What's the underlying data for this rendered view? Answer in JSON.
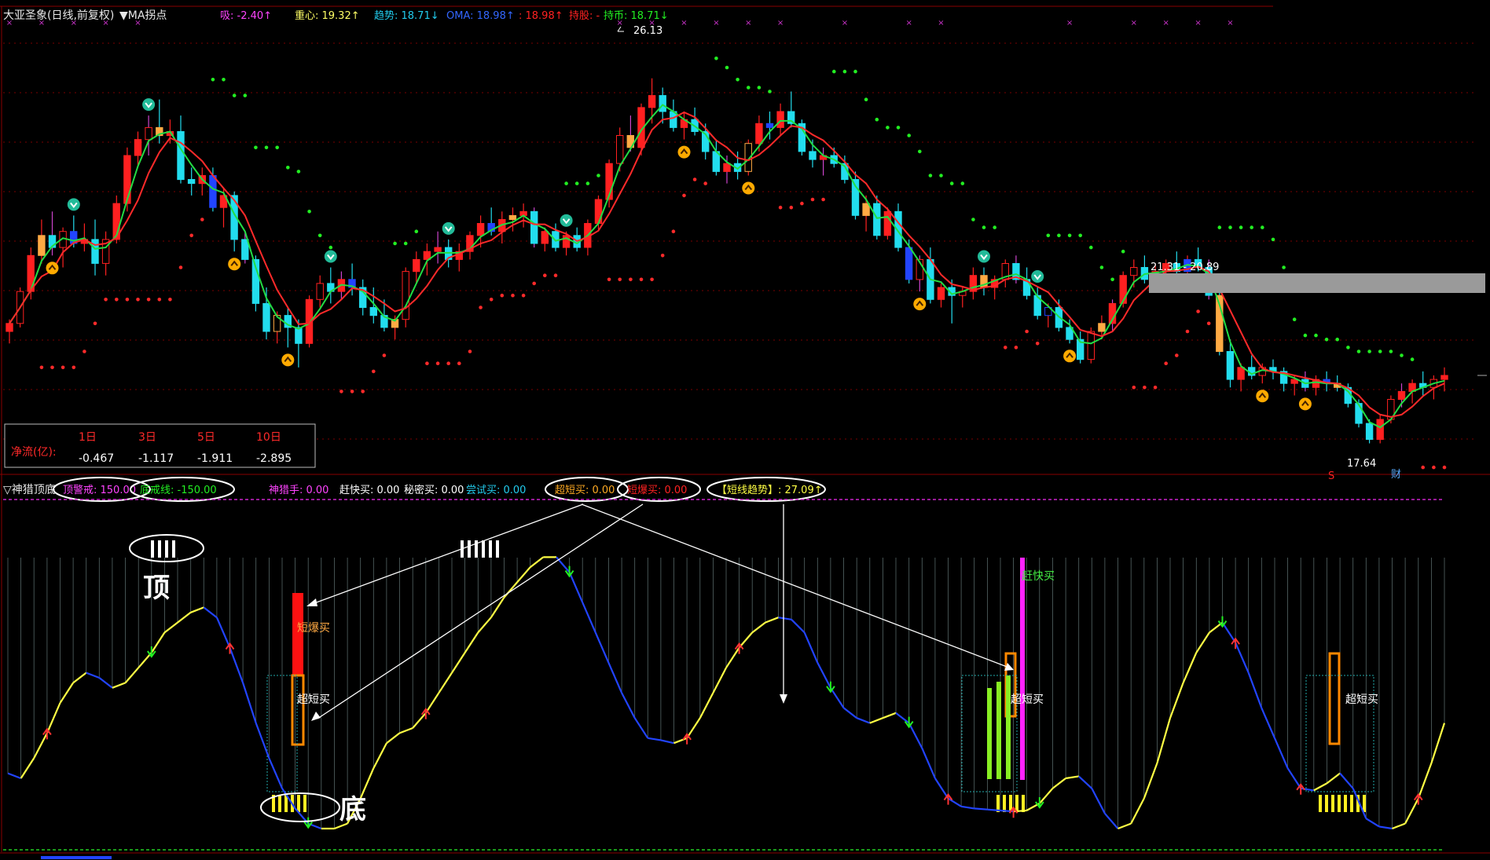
{
  "colors": {
    "bg": "#000000",
    "up": "#ff2020",
    "down": "#22ddee",
    "grid": "#7a0000",
    "ma_fast": "#ff2a2a",
    "ma_mid": "#22dd44",
    "dots_green": "#22ee22",
    "dots_red": "#ff2a2a",
    "osc_yellow": "#ffff44",
    "osc_blue": "#2244ff",
    "magenta": "#ff22ff",
    "white": "#ffffff"
  },
  "header": {
    "title": "大亚圣象(日线,前复权)",
    "ma_label": "▼MA拐点",
    "items": [
      {
        "label": "吸: -2.40",
        "color": "#ff44ff",
        "arrow": "up"
      },
      {
        "label": "重心: 19.32",
        "color": "#ffff66",
        "arrow": "up"
      },
      {
        "label": "趋势: 18.71",
        "color": "#22ccee",
        "arrow": "down"
      },
      {
        "label": "OMA: 18.98",
        "color": "#3366ff",
        "arrow": "up"
      },
      {
        "label": ": 18.98",
        "color": "#ff2222",
        "arrow": "up"
      },
      {
        "label": "持股: -",
        "color": "#ff2222",
        "arrow": "none"
      },
      {
        "label": "持币: 18.71",
        "color": "#22ee22",
        "arrow": "down"
      }
    ]
  },
  "price_annotations": {
    "high_label": "26.13",
    "low_label": "17.64",
    "range_label": "21.31 - 20.89",
    "marker_s": "S",
    "marker_cai": "财"
  },
  "netflow": {
    "row_label": "净流(亿):",
    "headers": [
      "1日",
      "3日",
      "5日",
      "10日"
    ],
    "values": [
      "-0.467",
      "-1.117",
      "-1.911",
      "-2.895"
    ]
  },
  "indicator": {
    "name": "▽神猎顶底",
    "items": [
      {
        "label": "顶警戒: 150.00",
        "color": "#ff44ff",
        "circled": true
      },
      {
        "label": "底戒线: -150.00",
        "color": "#22ee22",
        "circled": true
      },
      {
        "label": "神猎手: 0.00",
        "color": "#ff44ff",
        "circled": false
      },
      {
        "label": "赶快买: 0.00",
        "color": "#ffffff",
        "circled": false
      },
      {
        "label": "秘密买: 0.00",
        "color": "#ffffff",
        "circled": false
      },
      {
        "label": "尝试买: 0.00",
        "color": "#22ccee",
        "circled": false
      },
      {
        "label": "超短买: 0.00",
        "color": "#ffaa22",
        "circled": true
      },
      {
        "label": "短爆买: 0.00",
        "color": "#ff2222",
        "circled": true
      },
      {
        "label": "【短线趋势】: 27.09↑",
        "color": "#ffff44",
        "circled": true
      }
    ],
    "top_label": "顶",
    "bottom_label": "底",
    "bar_labels": {
      "duanbao": "短爆买",
      "chaoduan": "超短买",
      "gankuai": "赶快买"
    }
  },
  "chart_data": {
    "type": "candlestick",
    "title": "大亚圣象(日线,前复权)",
    "ylim": [
      16.5,
      27.5
    ],
    "annotated_high": 26.13,
    "annotated_low": 17.64,
    "candles": [
      [
        19.8,
        20.1,
        19.5,
        20.0
      ],
      [
        20.0,
        20.9,
        19.9,
        20.8
      ],
      [
        20.8,
        21.9,
        20.6,
        21.7
      ],
      [
        21.7,
        22.6,
        21.5,
        22.2
      ],
      [
        22.2,
        22.8,
        21.7,
        21.9
      ],
      [
        21.9,
        22.4,
        21.4,
        22.3
      ],
      [
        22.3,
        22.7,
        21.9,
        22.0
      ],
      [
        22.0,
        22.5,
        21.8,
        22.1
      ],
      [
        22.1,
        22.6,
        21.2,
        21.5
      ],
      [
        21.5,
        22.3,
        21.2,
        22.1
      ],
      [
        22.1,
        23.2,
        22.0,
        23.0
      ],
      [
        23.0,
        24.4,
        22.8,
        24.2
      ],
      [
        24.2,
        24.8,
        23.9,
        24.6
      ],
      [
        24.6,
        25.2,
        24.2,
        24.9
      ],
      [
        24.9,
        25.6,
        24.5,
        24.7
      ],
      [
        24.7,
        25.1,
        24.5,
        24.8
      ],
      [
        24.8,
        25.2,
        23.5,
        23.6
      ],
      [
        23.6,
        23.9,
        23.2,
        23.5
      ],
      [
        23.5,
        23.9,
        23.2,
        23.7
      ],
      [
        23.7,
        23.9,
        22.8,
        22.9
      ],
      [
        22.9,
        23.4,
        22.4,
        23.2
      ],
      [
        23.2,
        23.3,
        21.8,
        22.1
      ],
      [
        22.1,
        22.3,
        21.5,
        21.6
      ],
      [
        21.6,
        21.7,
        20.3,
        20.5
      ],
      [
        20.5,
        20.9,
        19.6,
        19.8
      ],
      [
        19.8,
        20.3,
        19.5,
        20.2
      ],
      [
        20.2,
        20.4,
        19.4,
        19.9
      ],
      [
        19.9,
        20.1,
        18.9,
        19.5
      ],
      [
        19.5,
        20.7,
        19.4,
        20.6
      ],
      [
        20.6,
        21.2,
        20.4,
        21.0
      ],
      [
        21.0,
        21.4,
        20.5,
        20.8
      ],
      [
        20.8,
        21.3,
        20.6,
        21.1
      ],
      [
        21.1,
        21.5,
        20.7,
        20.9
      ],
      [
        20.9,
        21.1,
        20.2,
        20.4
      ],
      [
        20.4,
        20.9,
        20.0,
        20.2
      ],
      [
        20.2,
        20.6,
        19.8,
        19.9
      ],
      [
        19.9,
        20.2,
        19.6,
        20.1
      ],
      [
        20.1,
        21.4,
        19.9,
        21.3
      ],
      [
        21.3,
        21.8,
        21.0,
        21.6
      ],
      [
        21.6,
        22.0,
        21.2,
        21.8
      ],
      [
        21.8,
        22.3,
        21.5,
        21.9
      ],
      [
        21.9,
        22.1,
        21.4,
        21.6
      ],
      [
        21.6,
        22.0,
        21.3,
        21.8
      ],
      [
        21.8,
        22.3,
        21.6,
        22.2
      ],
      [
        22.2,
        22.7,
        21.9,
        22.5
      ],
      [
        22.5,
        22.9,
        22.2,
        22.3
      ],
      [
        22.3,
        22.8,
        22.0,
        22.6
      ],
      [
        22.6,
        22.9,
        22.3,
        22.7
      ],
      [
        22.7,
        23.0,
        22.4,
        22.8
      ],
      [
        22.8,
        22.9,
        21.9,
        22.0
      ],
      [
        22.0,
        22.4,
        21.8,
        22.3
      ],
      [
        22.3,
        22.5,
        21.8,
        21.9
      ],
      [
        21.9,
        22.3,
        21.7,
        22.2
      ],
      [
        22.2,
        22.4,
        21.8,
        21.9
      ],
      [
        21.9,
        22.6,
        21.7,
        22.5
      ],
      [
        22.5,
        23.2,
        22.3,
        23.1
      ],
      [
        23.1,
        24.1,
        22.9,
        24.0
      ],
      [
        24.0,
        24.9,
        23.8,
        24.7
      ],
      [
        24.7,
        25.2,
        24.3,
        24.4
      ],
      [
        24.4,
        25.5,
        24.2,
        25.4
      ],
      [
        25.4,
        26.13,
        25.0,
        25.7
      ],
      [
        25.7,
        25.9,
        25.0,
        25.3
      ],
      [
        25.3,
        25.6,
        24.8,
        24.9
      ],
      [
        24.9,
        25.3,
        24.6,
        25.1
      ],
      [
        25.1,
        25.4,
        24.7,
        24.8
      ],
      [
        24.8,
        25.0,
        24.1,
        24.3
      ],
      [
        24.3,
        24.6,
        23.7,
        23.8
      ],
      [
        23.8,
        24.2,
        23.5,
        24.0
      ],
      [
        24.0,
        24.3,
        23.6,
        23.8
      ],
      [
        23.8,
        24.6,
        23.7,
        24.5
      ],
      [
        24.5,
        25.2,
        24.3,
        25.0
      ],
      [
        25.0,
        25.3,
        24.6,
        24.9
      ],
      [
        24.9,
        25.5,
        24.7,
        25.3
      ],
      [
        25.3,
        25.8,
        24.9,
        25.0
      ],
      [
        25.0,
        25.1,
        24.2,
        24.3
      ],
      [
        24.3,
        24.6,
        23.9,
        24.1
      ],
      [
        24.1,
        24.4,
        23.7,
        24.2
      ],
      [
        24.2,
        24.4,
        23.9,
        24.0
      ],
      [
        24.0,
        24.2,
        23.5,
        23.6
      ],
      [
        23.6,
        23.8,
        22.6,
        22.7
      ],
      [
        22.7,
        23.2,
        22.3,
        23.0
      ],
      [
        23.0,
        23.2,
        22.1,
        22.2
      ],
      [
        22.2,
        22.9,
        22.1,
        22.8
      ],
      [
        22.8,
        23.0,
        21.8,
        21.9
      ],
      [
        21.9,
        22.1,
        21.0,
        21.1
      ],
      [
        21.1,
        21.7,
        20.8,
        21.6
      ],
      [
        21.6,
        21.9,
        20.5,
        20.6
      ],
      [
        20.6,
        21.0,
        20.4,
        20.9
      ],
      [
        20.9,
        21.1,
        20.0,
        20.7
      ],
      [
        20.7,
        20.9,
        20.4,
        20.8
      ],
      [
        20.8,
        21.4,
        20.6,
        21.2
      ],
      [
        21.2,
        21.4,
        20.7,
        20.9
      ],
      [
        20.9,
        21.2,
        20.6,
        21.1
      ],
      [
        21.1,
        21.6,
        20.9,
        21.5
      ],
      [
        21.5,
        21.7,
        21.0,
        21.1
      ],
      [
        21.1,
        21.4,
        20.6,
        20.7
      ],
      [
        20.7,
        20.9,
        20.1,
        20.2
      ],
      [
        20.2,
        20.5,
        19.9,
        20.4
      ],
      [
        20.4,
        20.6,
        19.8,
        19.9
      ],
      [
        19.9,
        20.1,
        19.5,
        19.6
      ],
      [
        19.6,
        19.8,
        19.0,
        19.1
      ],
      [
        19.1,
        19.9,
        19.0,
        19.8
      ],
      [
        19.8,
        20.2,
        19.6,
        20.0
      ],
      [
        20.0,
        20.6,
        19.8,
        20.5
      ],
      [
        20.5,
        21.3,
        20.4,
        21.2
      ],
      [
        21.2,
        21.6,
        20.9,
        21.4
      ],
      [
        21.4,
        21.7,
        21.0,
        21.1
      ],
      [
        21.1,
        21.5,
        20.9,
        21.3
      ],
      [
        21.3,
        21.6,
        21.0,
        21.5
      ],
      [
        21.5,
        21.8,
        21.2,
        21.3
      ],
      [
        21.3,
        21.7,
        21.1,
        21.6
      ],
      [
        21.6,
        21.9,
        21.3,
        21.4
      ],
      [
        21.4,
        21.6,
        20.6,
        20.7
      ],
      [
        20.7,
        20.9,
        19.2,
        19.3
      ],
      [
        19.3,
        19.6,
        18.4,
        18.6
      ],
      [
        18.6,
        19.0,
        18.3,
        18.9
      ],
      [
        18.9,
        19.2,
        18.6,
        18.7
      ],
      [
        18.7,
        19.0,
        18.5,
        18.9
      ],
      [
        18.9,
        19.1,
        18.6,
        18.8
      ],
      [
        18.8,
        18.9,
        18.3,
        18.5
      ],
      [
        18.5,
        18.7,
        18.2,
        18.6
      ],
      [
        18.6,
        18.8,
        18.3,
        18.4
      ],
      [
        18.4,
        18.7,
        18.2,
        18.6
      ],
      [
        18.6,
        18.8,
        18.3,
        18.5
      ],
      [
        18.5,
        18.7,
        18.3,
        18.4
      ],
      [
        18.4,
        18.5,
        17.9,
        18.0
      ],
      [
        18.0,
        18.1,
        17.4,
        17.5
      ],
      [
        17.5,
        17.6,
        17.0,
        17.1
      ],
      [
        17.1,
        17.7,
        17.0,
        17.6
      ],
      [
        17.6,
        18.2,
        17.5,
        18.1
      ],
      [
        18.1,
        18.5,
        17.9,
        18.3
      ],
      [
        18.3,
        18.6,
        18.0,
        18.5
      ],
      [
        18.5,
        18.8,
        18.2,
        18.4
      ],
      [
        18.4,
        18.7,
        18.1,
        18.6
      ],
      [
        18.6,
        18.9,
        18.3,
        18.7
      ]
    ],
    "oscillator": [
      -95,
      -100,
      -80,
      -55,
      -25,
      -5,
      5,
      0,
      -10,
      -5,
      10,
      25,
      45,
      55,
      65,
      70,
      60,
      30,
      -5,
      -45,
      -80,
      -110,
      -130,
      -145,
      -150,
      -150,
      -145,
      -120,
      -90,
      -65,
      -55,
      -50,
      -35,
      -15,
      5,
      25,
      45,
      60,
      80,
      95,
      110,
      120,
      120,
      105,
      75,
      45,
      15,
      -15,
      -40,
      -60,
      -62,
      -65,
      -60,
      -40,
      -15,
      10,
      30,
      45,
      55,
      60,
      58,
      45,
      15,
      -10,
      -30,
      -40,
      -45,
      -40,
      -35,
      -45,
      -70,
      -100,
      -120,
      -128,
      -130,
      -131,
      -132,
      -133,
      -132,
      -125,
      -110,
      -100,
      -98,
      -110,
      -135,
      -150,
      -145,
      -120,
      -85,
      -40,
      -5,
      25,
      45,
      55,
      35,
      5,
      -30,
      -60,
      -90,
      -110,
      -112,
      -105,
      -95,
      -110,
      -140,
      -148,
      -150,
      -145,
      -120,
      -85,
      -45
    ]
  }
}
